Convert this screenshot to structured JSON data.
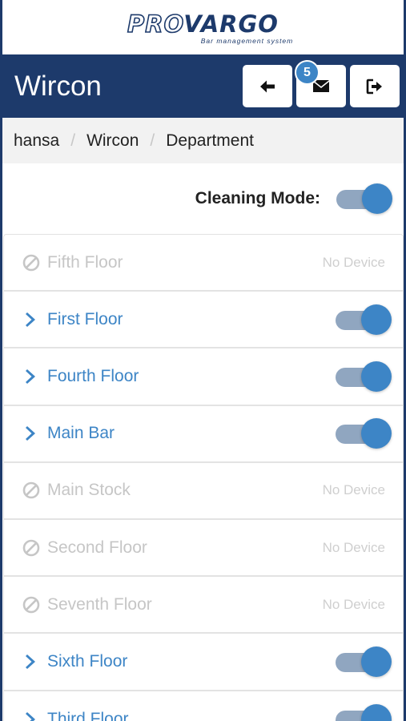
{
  "logo": {
    "pro": "PRO",
    "vargo": "VARGO",
    "tagline": "Bar management system"
  },
  "header": {
    "title": "Wircon",
    "messages_count": "5"
  },
  "breadcrumb": {
    "items": [
      "hansa",
      "Wircon",
      "Department"
    ]
  },
  "cleaning_mode": {
    "label": "Cleaning Mode:",
    "enabled": true
  },
  "departments": [
    {
      "name": "Fifth Floor",
      "status": "No Device"
    },
    {
      "name": "First Floor",
      "enabled": true
    },
    {
      "name": "Fourth Floor",
      "enabled": true
    },
    {
      "name": "Main Bar",
      "enabled": true
    },
    {
      "name": "Main Stock",
      "status": "No Device"
    },
    {
      "name": "Second Floor",
      "status": "No Device"
    },
    {
      "name": "Seventh Floor",
      "status": "No Device"
    },
    {
      "name": "Sixth Floor",
      "enabled": true
    },
    {
      "name": "Third Floor",
      "enabled": true
    }
  ],
  "colors": {
    "navy": "#1d3a6b",
    "accent": "#3d85c6",
    "disabled": "#c6c6c6"
  }
}
